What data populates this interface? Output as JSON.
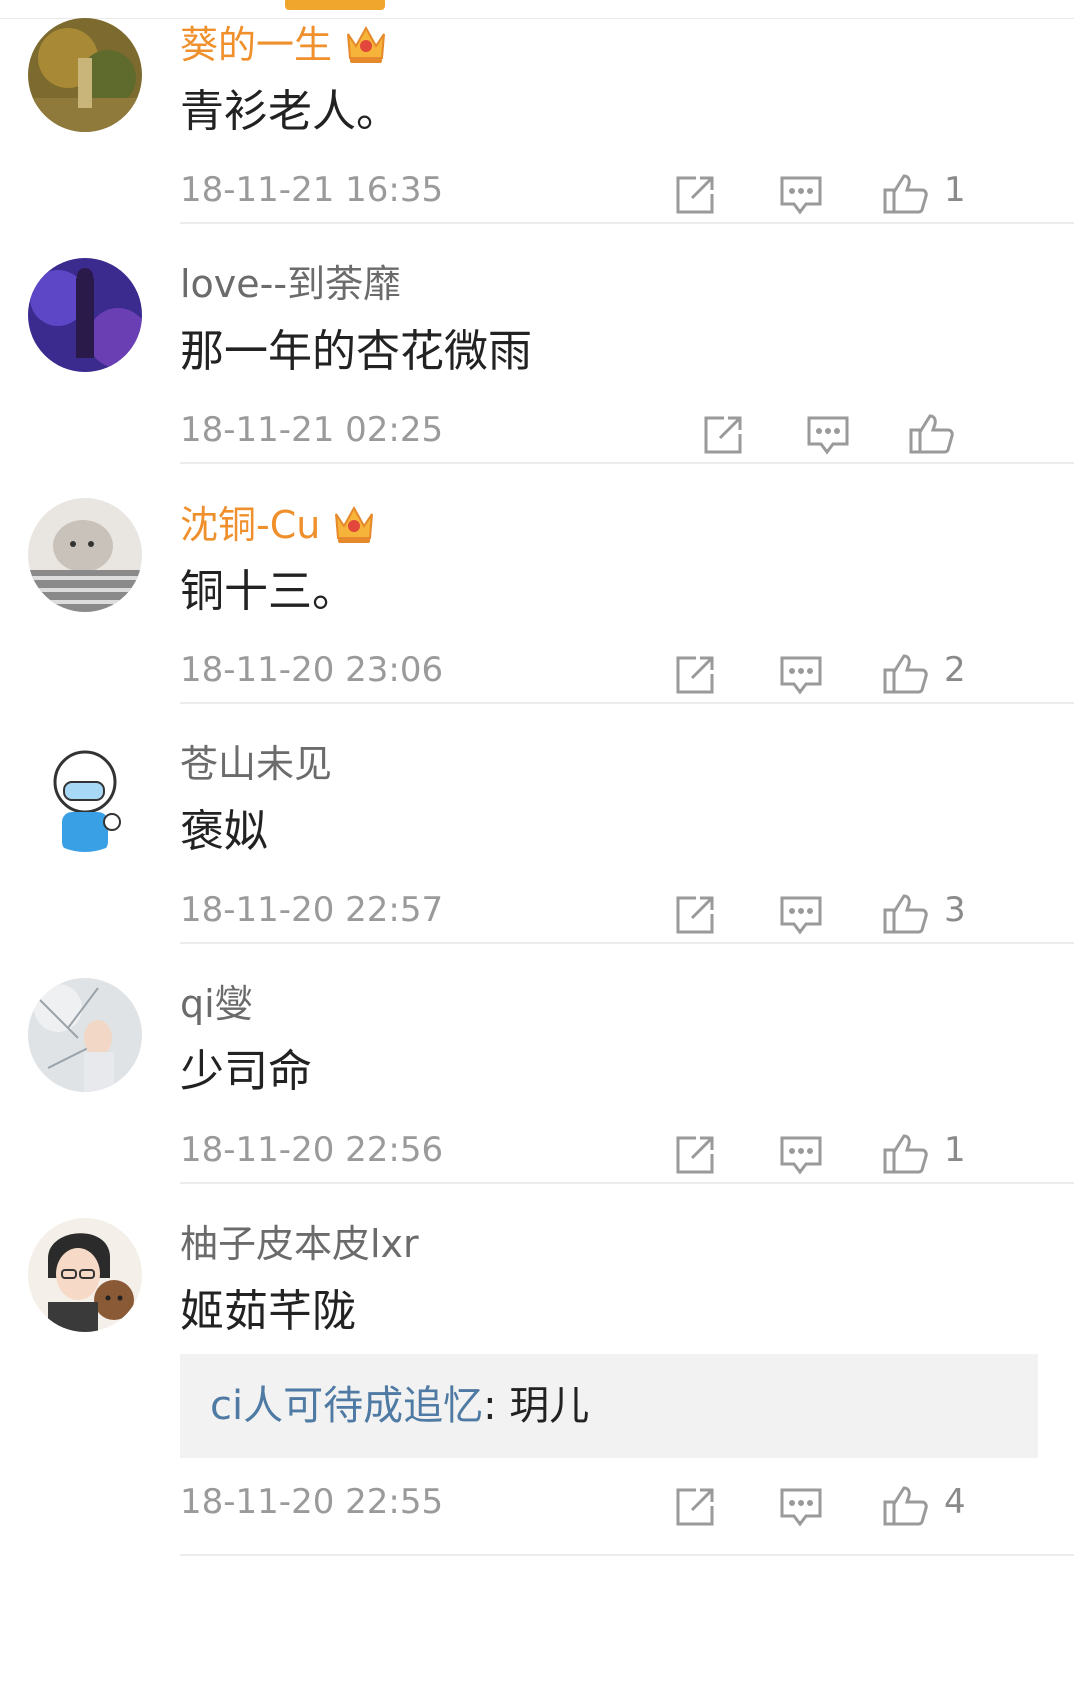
{
  "comments": [
    {
      "user": "葵的一生",
      "vip": true,
      "text": "青衫老人。",
      "time": "18-11-21 16:35",
      "likes": "1"
    },
    {
      "user": "love--到荼靡",
      "vip": false,
      "text": "那一年的杏花微雨",
      "time": "18-11-21 02:25",
      "likes": ""
    },
    {
      "user": "沈铜-Cu",
      "vip": true,
      "text": "铜十三。",
      "time": "18-11-20 23:06",
      "likes": "2"
    },
    {
      "user": "苍山未见",
      "vip": false,
      "text": "褒姒",
      "time": "18-11-20 22:57",
      "likes": "3"
    },
    {
      "user": "qi燮",
      "vip": false,
      "text": "少司命",
      "time": "18-11-20 22:56",
      "likes": "1"
    },
    {
      "user": "柚子皮本皮lxr",
      "vip": false,
      "text": "姬茹芊陇",
      "time": "18-11-20 22:55",
      "likes": "4",
      "reply": {
        "user": "ci人可待成追忆",
        "separator": ": ",
        "text": "玥儿"
      }
    }
  ],
  "icons": [
    "share-icon",
    "comment-icon",
    "thumbs-up-icon",
    "vip-crown-icon"
  ],
  "colors": {
    "vip_name": "#f0902d",
    "reply_user": "#4e7aa3",
    "tab_indicator": "#f0a52d"
  }
}
